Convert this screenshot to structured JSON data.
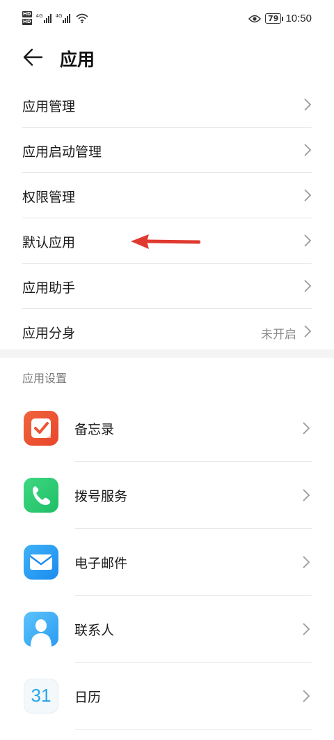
{
  "status_bar": {
    "hd_badge": "HD",
    "network_1": "4G",
    "network_2": "4G",
    "battery": "79",
    "time": "10:50"
  },
  "header": {
    "title": "应用"
  },
  "menu": {
    "items": [
      {
        "label": "应用管理"
      },
      {
        "label": "应用启动管理"
      },
      {
        "label": "权限管理"
      },
      {
        "label": "默认应用"
      },
      {
        "label": "应用助手"
      },
      {
        "label": "应用分身",
        "value": "未开启"
      }
    ]
  },
  "app_settings": {
    "section_title": "应用设置",
    "apps": [
      {
        "label": "备忘录",
        "icon": "notes-icon"
      },
      {
        "label": "拨号服务",
        "icon": "phone-icon"
      },
      {
        "label": "电子邮件",
        "icon": "email-icon"
      },
      {
        "label": "联系人",
        "icon": "contacts-icon"
      },
      {
        "label": "日历",
        "icon": "calendar-icon",
        "icon_text": "31"
      }
    ]
  },
  "colors": {
    "annotation_arrow": "#e0392f",
    "notes": "#ec5433",
    "phone": "#2bcb72",
    "email": "#2a9cf2",
    "calendar_text": "#29a6e6"
  }
}
